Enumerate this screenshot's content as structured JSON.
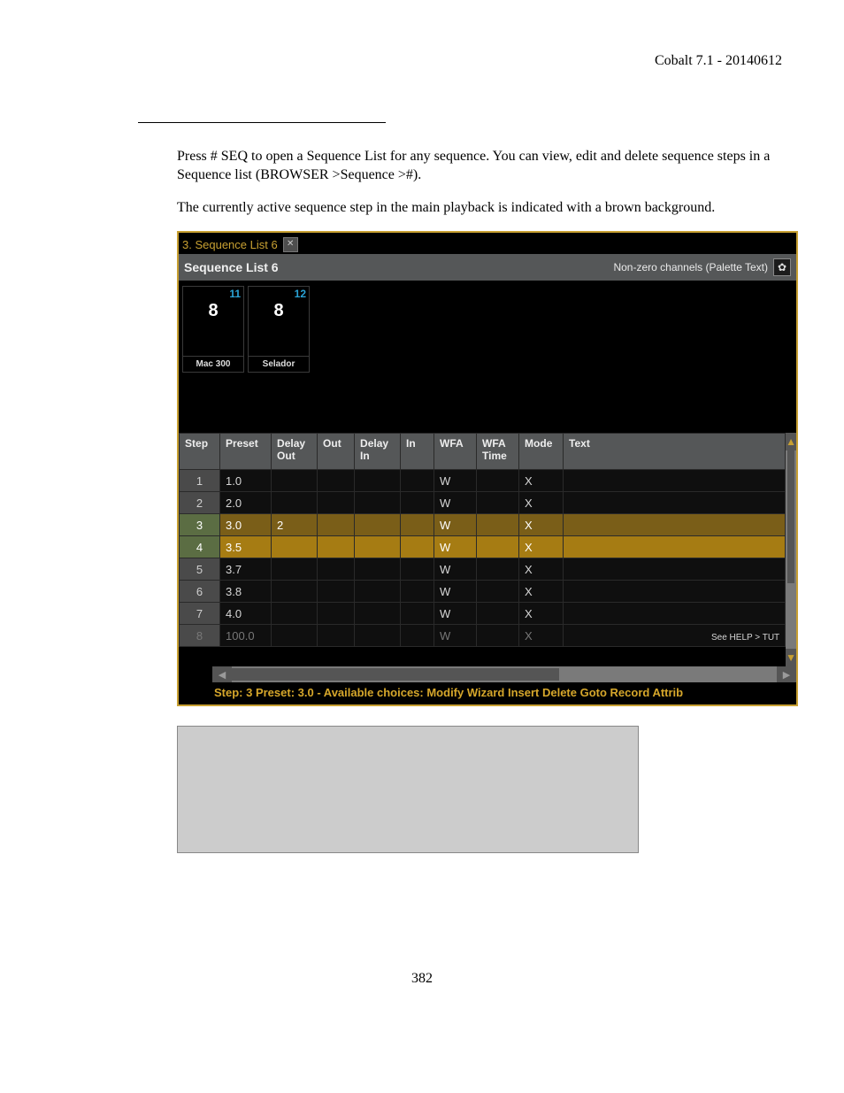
{
  "doc": {
    "header_right": "Cobalt 7.1 - 20140612",
    "para1": "Press # SEQ to open a Sequence List for any sequence. You can view, edit and delete sequence steps in a Sequence list (BROWSER >Sequence >#).",
    "para2": "The currently active sequence step in the main playback is indicated with a brown background.",
    "page_number": "382"
  },
  "app": {
    "tab_title": "3. Sequence List 6",
    "close_glyph": "✕",
    "panel_title": "Sequence List 6",
    "subtitle_right": "Non-zero channels (Palette Text)",
    "gear_glyph": "✿",
    "channels": [
      {
        "ch": "11",
        "val": "8",
        "label": "Mac 300"
      },
      {
        "ch": "12",
        "val": "8",
        "label": "Selador"
      }
    ],
    "columns": [
      "Step",
      "Preset",
      "Delay Out",
      "Out",
      "Delay In",
      "In",
      "WFA",
      "WFA Time",
      "Mode",
      "Text"
    ],
    "rows": [
      {
        "step": "1",
        "preset": "1.0",
        "dout": "",
        "out": "",
        "din": "",
        "in": "",
        "wfa": "W",
        "wfat": "",
        "mode": "X",
        "text": "",
        "state": ""
      },
      {
        "step": "2",
        "preset": "2.0",
        "dout": "",
        "out": "",
        "din": "",
        "in": "",
        "wfa": "W",
        "wfat": "",
        "mode": "X",
        "text": "",
        "state": ""
      },
      {
        "step": "3",
        "preset": "3.0",
        "dout": "2",
        "out": "",
        "din": "",
        "in": "",
        "wfa": "W",
        "wfat": "",
        "mode": "X",
        "text": "",
        "state": "selected"
      },
      {
        "step": "4",
        "preset": "3.5",
        "dout": "",
        "out": "",
        "din": "",
        "in": "",
        "wfa": "W",
        "wfat": "",
        "mode": "X",
        "text": "",
        "state": "active"
      },
      {
        "step": "5",
        "preset": "3.7",
        "dout": "",
        "out": "",
        "din": "",
        "in": "",
        "wfa": "W",
        "wfat": "",
        "mode": "X",
        "text": "",
        "state": ""
      },
      {
        "step": "6",
        "preset": "3.8",
        "dout": "",
        "out": "",
        "din": "",
        "in": "",
        "wfa": "W",
        "wfat": "",
        "mode": "X",
        "text": "",
        "state": ""
      },
      {
        "step": "7",
        "preset": "4.0",
        "dout": "",
        "out": "",
        "din": "",
        "in": "",
        "wfa": "W",
        "wfat": "",
        "mode": "X",
        "text": "",
        "state": ""
      },
      {
        "step": "8",
        "preset": "100.0",
        "dout": "",
        "out": "",
        "din": "",
        "in": "",
        "wfa": "W",
        "wfat": "",
        "mode": "X",
        "text": "",
        "state": "dim"
      }
    ],
    "status_bar": "Step: 3 Preset: 3.0 - Available choices: Modify Wizard Insert Delete Goto Record Attrib",
    "hint_tail": "See HELP > TUT",
    "scroll": {
      "up_glyph": "▲",
      "down_glyph": "▼",
      "left_glyph": "◀",
      "right_glyph": "▶"
    }
  }
}
